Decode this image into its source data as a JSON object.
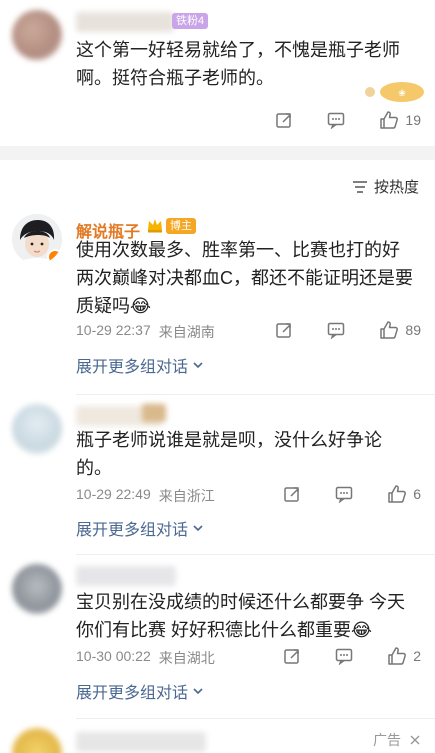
{
  "comments": [
    {
      "badge": "铁粉4",
      "text": "这个第一好轻易就给了，不愧是瓶子老师啊。挺符合瓶子老师的。",
      "likes": "19"
    },
    {
      "username": "解说瓶子",
      "host_badge": "博主",
      "text": "使用次数最多、胜率第一、比赛也打的好 两次巅峰对决都血C，都还不能证明还是要质疑吗😂",
      "time": "10-29 22:37",
      "location": "来自湖南",
      "likes": "89",
      "expand": "展开更多组对话"
    },
    {
      "text": "瓶子老师说谁是就是呗，没什么好争论的。",
      "time": "10-29 22:49",
      "location": "来自浙江",
      "likes": "6",
      "expand": "展开更多组对话"
    },
    {
      "text": "宝贝别在没成绩的时候还什么都要争 今天你们有比赛 好好积德比什么都重要😂",
      "time": "10-30 00:22",
      "location": "来自湖北",
      "likes": "2",
      "expand": "展开更多组对话"
    }
  ],
  "sort": {
    "label": "按热度",
    "icon": "sort-icon"
  },
  "ad": {
    "label": "广告"
  },
  "colors": {
    "username": "#e27a25",
    "link": "#4a6891",
    "meta": "#8a8a8a",
    "badge": "#f5a623"
  }
}
